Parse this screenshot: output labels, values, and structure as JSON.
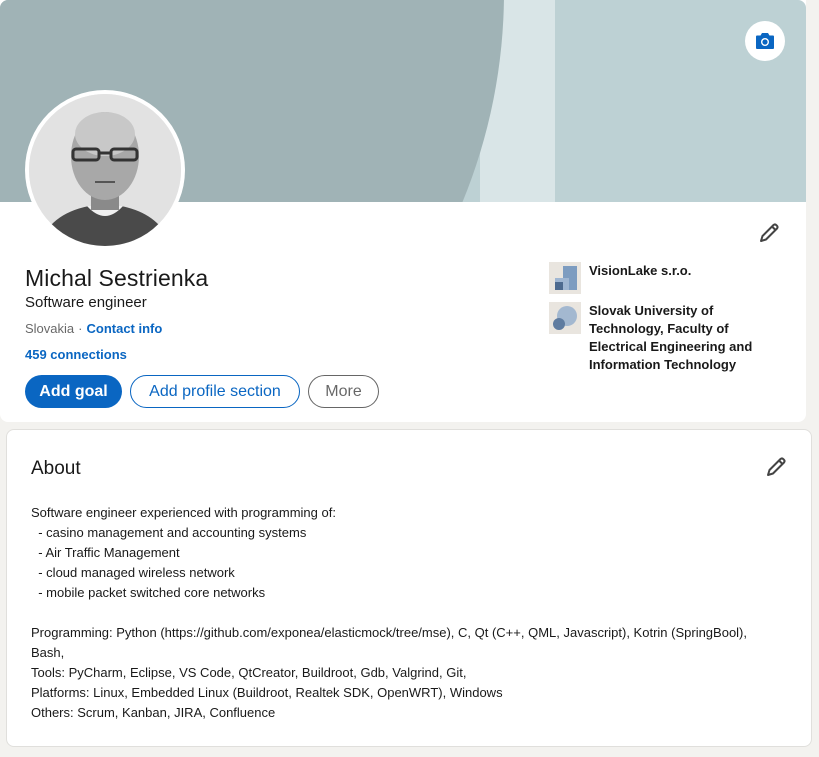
{
  "profile": {
    "name": "Michal Sestrienka",
    "headline": "Software engineer",
    "location": "Slovakia",
    "location_separator": "·",
    "contact_info_label": "Contact info",
    "connections_label": "459 connections"
  },
  "buttons": {
    "add_goal": "Add goal",
    "add_profile_section": "Add profile section",
    "more": "More"
  },
  "organizations": [
    {
      "name": "VisionLake s.r.o.",
      "icon": "company-logo-icon"
    },
    {
      "name": "Slovak University of Technology, Faculty of Electrical Engineering and Information Technology",
      "icon": "school-logo-icon"
    }
  ],
  "about": {
    "title": "About",
    "text": "Software engineer experienced with programming of:\n  - casino management and accounting systems\n  - Air Traffic Management\n  - cloud managed wireless network\n  - mobile packet switched core networks\n\nProgramming: Python (https://github.com/exponea/elasticmock/tree/mse), C, Qt (C++, QML, Javascript), Kotrin (SpringBool), Bash,\nTools: PyCharm, Eclipse, VS Code, QtCreator, Buildroot, Gdb, Valgrind, Git,\nPlatforms: Linux, Embedded Linux (Buildroot, Realtek SDK, OpenWRT), Windows\nOthers: Scrum, Kanban, JIRA, Confluence"
  },
  "colors": {
    "accent": "#0a66c2",
    "banner_light": "#bdd1d4",
    "banner_dark": "#a0b3b6",
    "background": "#f3f2ef"
  }
}
